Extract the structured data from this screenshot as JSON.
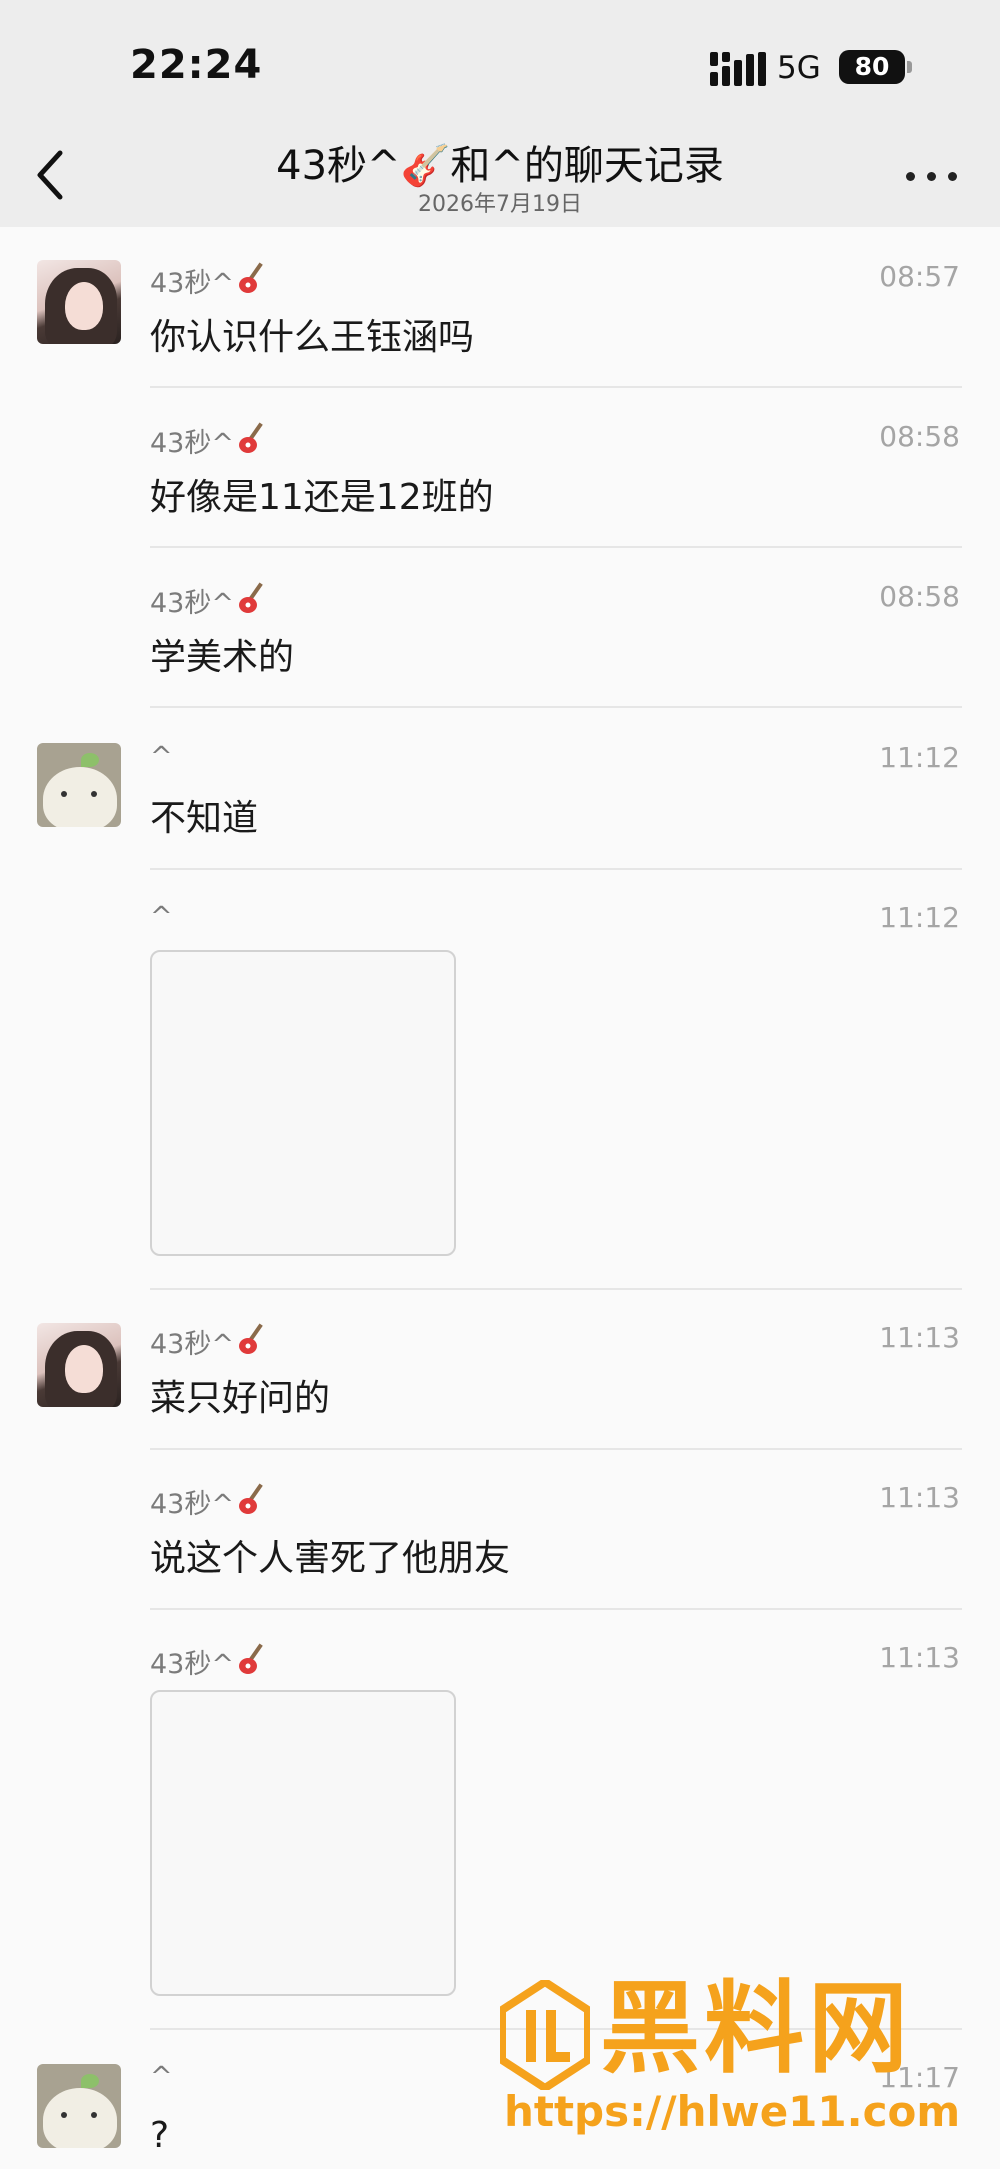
{
  "status_bar": {
    "time": "22:24",
    "network": "5G",
    "battery": "80"
  },
  "nav": {
    "title": "43秒^🎸和^的聊天记录",
    "subtitle": "2026年7月19日"
  },
  "messages": [
    {
      "sender": "43秒^",
      "time": "08:57",
      "text": "你认识什么王钰涵吗"
    },
    {
      "sender": "43秒^",
      "time": "08:58",
      "text": "好像是11还是12班的"
    },
    {
      "sender": "43秒^",
      "time": "08:58",
      "text": "学美术的"
    },
    {
      "sender": "^",
      "time": "11:12",
      "text": "不知道"
    },
    {
      "sender": "^",
      "time": "11:12",
      "text": ""
    },
    {
      "sender": "43秒^",
      "time": "11:13",
      "text": "菜只好问的"
    },
    {
      "sender": "43秒^",
      "time": "11:13",
      "text": "说这个人害死了他朋友"
    },
    {
      "sender": "43秒^",
      "time": "11:13",
      "text": ""
    },
    {
      "sender": "^",
      "time": "11:17",
      "text": "?"
    }
  ],
  "watermark": {
    "title": "黑料网",
    "url": "https://hlwe11.com"
  },
  "colors": {
    "header_bg": "#ededed",
    "page_bg": "#fafafa",
    "watermark": "#f5a21c"
  }
}
